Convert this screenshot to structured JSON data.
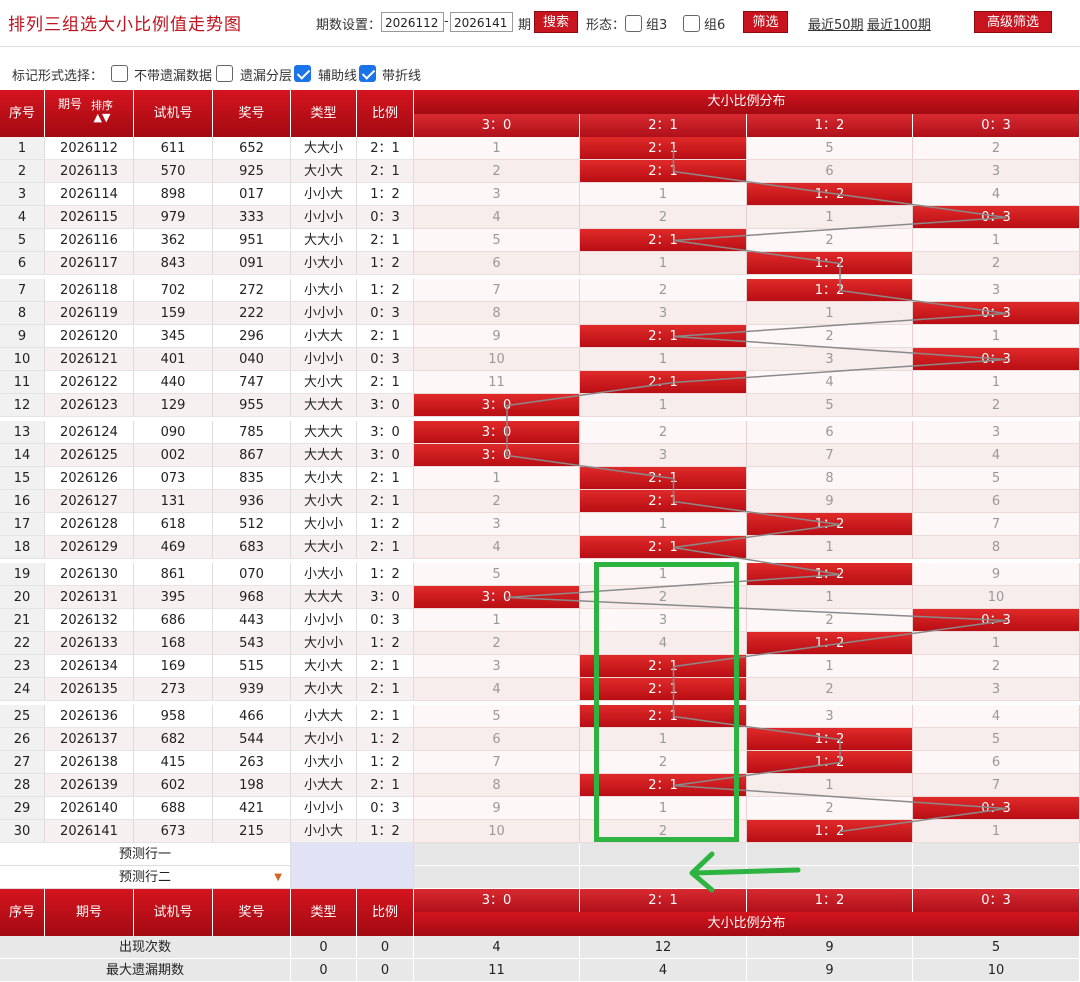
{
  "header": {
    "title": "排列三组选大小比例值走势图",
    "period_label": "期数设置：",
    "period_from": "2026112",
    "period_dash": "-",
    "period_to": "2026141",
    "period_unit": "期",
    "search_label": "搜索",
    "shape_label": "形态：",
    "group3_label": "组3",
    "group6_label": "组6",
    "filter_label": "筛选",
    "recent50_label": "最近50期",
    "recent100_label": "最近100期",
    "advanced_label": "高级筛选"
  },
  "markbar": {
    "label": "标记形式选择：",
    "options": [
      {
        "label": "不带遗漏数据",
        "checked": false
      },
      {
        "label": "遗漏分层",
        "checked": false
      },
      {
        "label": "辅助线",
        "checked": true
      },
      {
        "label": "带折线",
        "checked": true
      }
    ]
  },
  "table": {
    "headers": {
      "seq": "序号",
      "issue": "期号",
      "sort": "排序",
      "trial": "试机号",
      "prize": "奖号",
      "type": "类型",
      "ratio": "比例",
      "dist": "大小比例分布"
    },
    "ratio_cols": [
      "3：0",
      "2：1",
      "1：2",
      "0：3"
    ],
    "rows": [
      {
        "seq": "1",
        "issue": "2026112",
        "trial": "611",
        "prize": "652",
        "type": "大大小",
        "ratio": "2：1",
        "hit": 1,
        "cells": [
          "1",
          "2：1",
          "5",
          "2"
        ]
      },
      {
        "seq": "2",
        "issue": "2026113",
        "trial": "570",
        "prize": "925",
        "type": "大小大",
        "ratio": "2：1",
        "hit": 1,
        "cells": [
          "2",
          "2：1",
          "6",
          "3"
        ]
      },
      {
        "seq": "3",
        "issue": "2026114",
        "trial": "898",
        "prize": "017",
        "type": "小小大",
        "ratio": "1：2",
        "hit": 2,
        "cells": [
          "3",
          "1",
          "1：2",
          "4"
        ]
      },
      {
        "seq": "4",
        "issue": "2026115",
        "trial": "979",
        "prize": "333",
        "type": "小小小",
        "ratio": "0：3",
        "hit": 3,
        "cells": [
          "4",
          "2",
          "1",
          "0：3"
        ]
      },
      {
        "seq": "5",
        "issue": "2026116",
        "trial": "362",
        "prize": "951",
        "type": "大大小",
        "ratio": "2：1",
        "hit": 1,
        "cells": [
          "5",
          "2：1",
          "2",
          "1"
        ]
      },
      {
        "seq": "6",
        "issue": "2026117",
        "trial": "843",
        "prize": "091",
        "type": "小大小",
        "ratio": "1：2",
        "hit": 2,
        "cells": [
          "6",
          "1",
          "1：2",
          "2"
        ]
      },
      {
        "seq": "7",
        "issue": "2026118",
        "trial": "702",
        "prize": "272",
        "type": "小大小",
        "ratio": "1：2",
        "hit": 2,
        "cells": [
          "7",
          "2",
          "1：2",
          "3"
        ]
      },
      {
        "seq": "8",
        "issue": "2026119",
        "trial": "159",
        "prize": "222",
        "type": "小小小",
        "ratio": "0：3",
        "hit": 3,
        "cells": [
          "8",
          "3",
          "1",
          "0：3"
        ]
      },
      {
        "seq": "9",
        "issue": "2026120",
        "trial": "345",
        "prize": "296",
        "type": "小大大",
        "ratio": "2：1",
        "hit": 1,
        "cells": [
          "9",
          "2：1",
          "2",
          "1"
        ]
      },
      {
        "seq": "10",
        "issue": "2026121",
        "trial": "401",
        "prize": "040",
        "type": "小小小",
        "ratio": "0：3",
        "hit": 3,
        "cells": [
          "10",
          "1",
          "3",
          "0：3"
        ]
      },
      {
        "seq": "11",
        "issue": "2026122",
        "trial": "440",
        "prize": "747",
        "type": "大小大",
        "ratio": "2：1",
        "hit": 1,
        "cells": [
          "11",
          "2：1",
          "4",
          "1"
        ]
      },
      {
        "seq": "12",
        "issue": "2026123",
        "trial": "129",
        "prize": "955",
        "type": "大大大",
        "ratio": "3：0",
        "hit": 0,
        "cells": [
          "3：0",
          "1",
          "5",
          "2"
        ]
      },
      {
        "seq": "13",
        "issue": "2026124",
        "trial": "090",
        "prize": "785",
        "type": "大大大",
        "ratio": "3：0",
        "hit": 0,
        "cells": [
          "3：0",
          "2",
          "6",
          "3"
        ]
      },
      {
        "seq": "14",
        "issue": "2026125",
        "trial": "002",
        "prize": "867",
        "type": "大大大",
        "ratio": "3：0",
        "hit": 0,
        "cells": [
          "3：0",
          "3",
          "7",
          "4"
        ]
      },
      {
        "seq": "15",
        "issue": "2026126",
        "trial": "073",
        "prize": "835",
        "type": "大小大",
        "ratio": "2：1",
        "hit": 1,
        "cells": [
          "1",
          "2：1",
          "8",
          "5"
        ]
      },
      {
        "seq": "16",
        "issue": "2026127",
        "trial": "131",
        "prize": "936",
        "type": "大小大",
        "ratio": "2：1",
        "hit": 1,
        "cells": [
          "2",
          "2：1",
          "9",
          "6"
        ]
      },
      {
        "seq": "17",
        "issue": "2026128",
        "trial": "618",
        "prize": "512",
        "type": "大小小",
        "ratio": "1：2",
        "hit": 2,
        "cells": [
          "3",
          "1",
          "1：2",
          "7"
        ]
      },
      {
        "seq": "18",
        "issue": "2026129",
        "trial": "469",
        "prize": "683",
        "type": "大大小",
        "ratio": "2：1",
        "hit": 1,
        "cells": [
          "4",
          "2：1",
          "1",
          "8"
        ]
      },
      {
        "seq": "19",
        "issue": "2026130",
        "trial": "861",
        "prize": "070",
        "type": "小大小",
        "ratio": "1：2",
        "hit": 2,
        "cells": [
          "5",
          "1",
          "1：2",
          "9"
        ]
      },
      {
        "seq": "20",
        "issue": "2026131",
        "trial": "395",
        "prize": "968",
        "type": "大大大",
        "ratio": "3：0",
        "hit": 0,
        "cells": [
          "3：0",
          "2",
          "1",
          "10"
        ]
      },
      {
        "seq": "21",
        "issue": "2026132",
        "trial": "686",
        "prize": "443",
        "type": "小小小",
        "ratio": "0：3",
        "hit": 3,
        "cells": [
          "1",
          "3",
          "2",
          "0：3"
        ]
      },
      {
        "seq": "22",
        "issue": "2026133",
        "trial": "168",
        "prize": "543",
        "type": "大小小",
        "ratio": "1：2",
        "hit": 2,
        "cells": [
          "2",
          "4",
          "1：2",
          "1"
        ]
      },
      {
        "seq": "23",
        "issue": "2026134",
        "trial": "169",
        "prize": "515",
        "type": "大小大",
        "ratio": "2：1",
        "hit": 1,
        "cells": [
          "3",
          "2：1",
          "1",
          "2"
        ]
      },
      {
        "seq": "24",
        "issue": "2026135",
        "trial": "273",
        "prize": "939",
        "type": "大小大",
        "ratio": "2：1",
        "hit": 1,
        "cells": [
          "4",
          "2：1",
          "2",
          "3"
        ]
      },
      {
        "seq": "25",
        "issue": "2026136",
        "trial": "958",
        "prize": "466",
        "type": "小大大",
        "ratio": "2：1",
        "hit": 1,
        "cells": [
          "5",
          "2：1",
          "3",
          "4"
        ]
      },
      {
        "seq": "26",
        "issue": "2026137",
        "trial": "682",
        "prize": "544",
        "type": "大小小",
        "ratio": "1：2",
        "hit": 2,
        "cells": [
          "6",
          "1",
          "1：2",
          "5"
        ]
      },
      {
        "seq": "27",
        "issue": "2026138",
        "trial": "415",
        "prize": "263",
        "type": "小大小",
        "ratio": "1：2",
        "hit": 2,
        "cells": [
          "7",
          "2",
          "1：2",
          "6"
        ]
      },
      {
        "seq": "28",
        "issue": "2026139",
        "trial": "602",
        "prize": "198",
        "type": "小大大",
        "ratio": "2：1",
        "hit": 1,
        "cells": [
          "8",
          "2：1",
          "1",
          "7"
        ]
      },
      {
        "seq": "29",
        "issue": "2026140",
        "trial": "688",
        "prize": "421",
        "type": "小小小",
        "ratio": "0：3",
        "hit": 3,
        "cells": [
          "9",
          "1",
          "2",
          "0：3"
        ]
      },
      {
        "seq": "30",
        "issue": "2026141",
        "trial": "673",
        "prize": "215",
        "type": "小小大",
        "ratio": "1：2",
        "hit": 2,
        "cells": [
          "10",
          "2",
          "1：2",
          "1"
        ]
      }
    ],
    "predict1": "预测行一",
    "predict2": "预测行二",
    "stats": [
      {
        "label": "出现次数",
        "type": "0",
        "ratio": "0",
        "values": [
          "4",
          "12",
          "9",
          "5"
        ]
      },
      {
        "label": "最大遗漏期数",
        "type": "0",
        "ratio": "0",
        "values": [
          "11",
          "4",
          "9",
          "10"
        ]
      }
    ]
  },
  "colors": {
    "brand_red": "#c8141e",
    "annotation_green": "#2db340",
    "checkbox_blue": "#1a73e8"
  }
}
